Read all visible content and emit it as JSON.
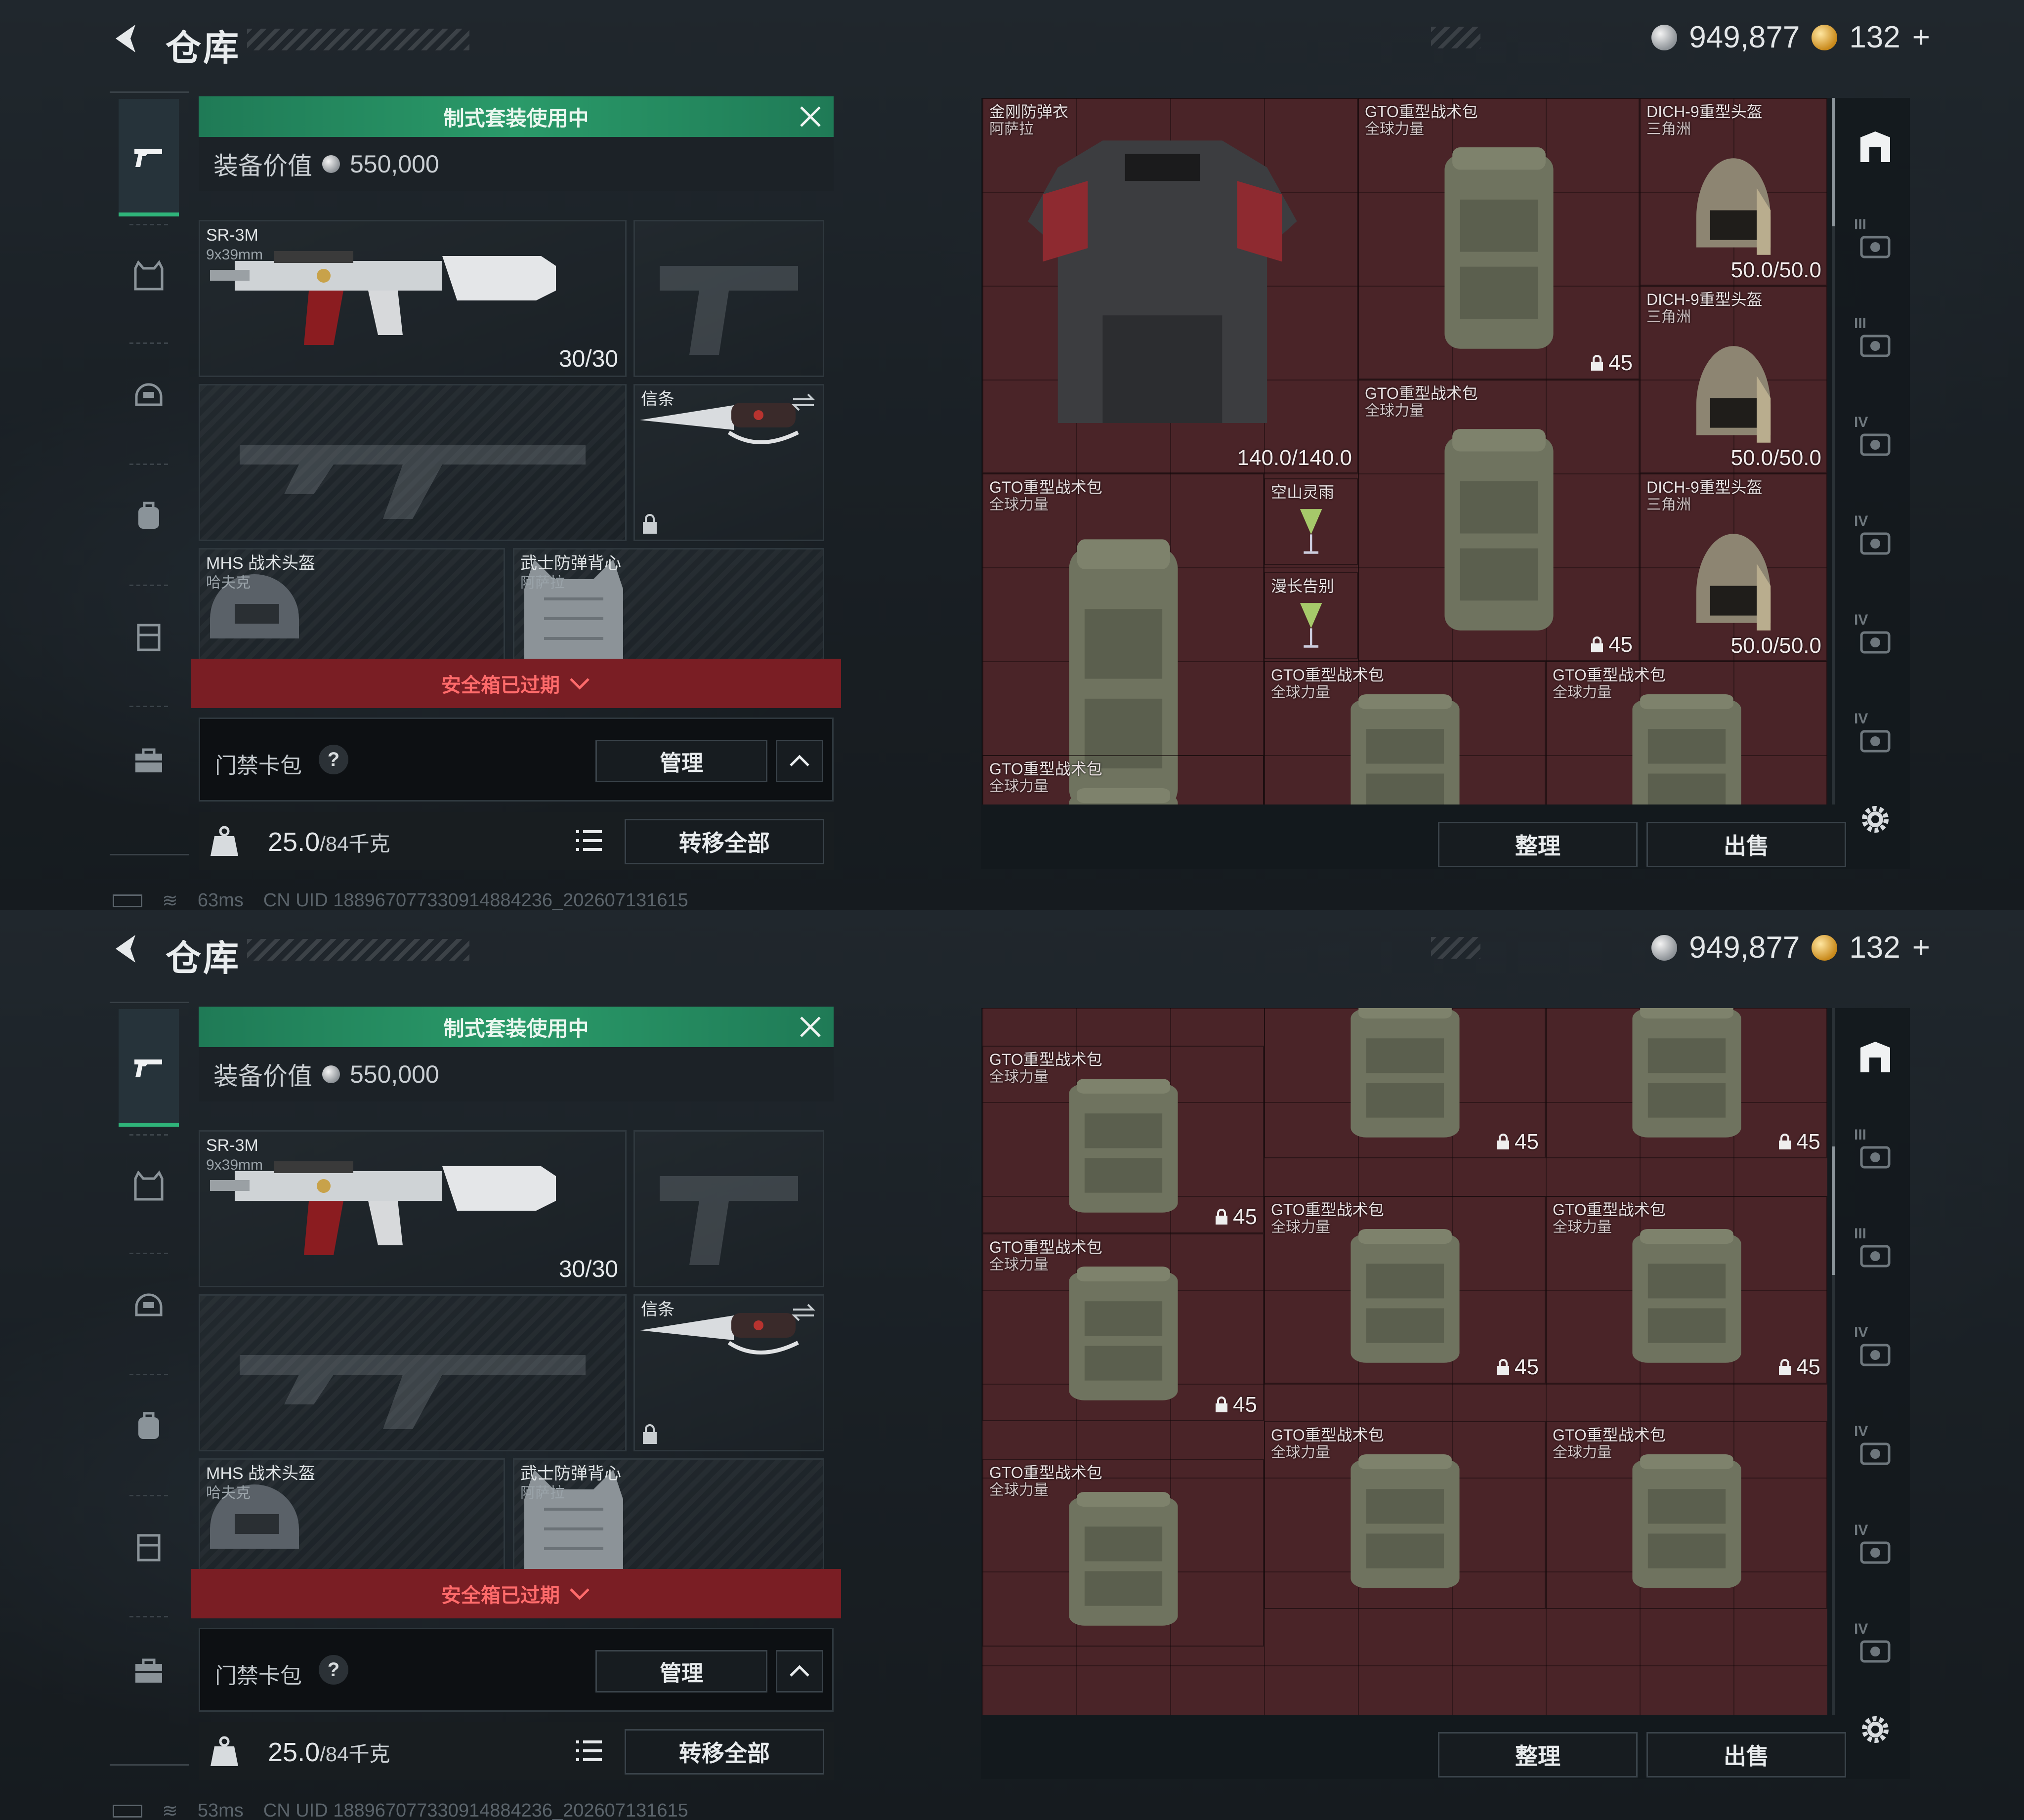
{
  "header": {
    "title": "仓库",
    "silver_amount": "949,877",
    "gold_amount": "132",
    "gold_plus": "+"
  },
  "nav": {
    "items": [
      "gun-icon",
      "vest-icon",
      "helmet-icon",
      "backpack-icon",
      "rig-icon",
      "briefcase-icon"
    ],
    "active": 0
  },
  "loadout": {
    "banner": "制式套装使用中",
    "equip_value_label": "装备价值",
    "equip_value": "550,000",
    "weapon": {
      "name": "SR-3M",
      "caliber": "9x39mm",
      "ammo": "30/30"
    },
    "melee": {
      "label": "信条"
    },
    "helmet": {
      "name": "MHS 战术头盔",
      "sub": "哈夫克"
    },
    "armor": {
      "name": "武士防弹背心",
      "sub": "阿萨拉"
    },
    "safe_box": "安全箱已过期",
    "card_pack": "门禁卡包",
    "help": "?",
    "manage": "管理",
    "weight": "25.0",
    "weight_unit": "/84千克",
    "transfer_all": "转移全部"
  },
  "status": {
    "ping_top": "63ms",
    "ping_bottom": "53ms",
    "uid": "CN UID 1889670773309148842​36_202607131615"
  },
  "stash": {
    "sort_label": "整理",
    "sell_label": "出售",
    "top_items": [
      {
        "name": "金刚防弹衣",
        "sub": "阿萨拉",
        "value": "140.0/140.0"
      },
      {
        "name": "GTO重型战术包",
        "sub": "全球力量",
        "cap": "45"
      },
      {
        "name": "DICH-9重型头盔",
        "sub": "三角洲",
        "value": "50.0/50.0"
      },
      {
        "name": "DICH-9重型头盔",
        "sub": "三角洲",
        "value": "50.0/50.0"
      },
      {
        "name": "GTO重型战术包",
        "sub": "全球力量",
        "cap": "45"
      },
      {
        "name": "DICH-9重型头盔",
        "sub": "三角洲",
        "value": "50.0/50.0"
      },
      {
        "name": "GTO重型战术包",
        "sub": "全球力量",
        "cap": "45"
      },
      {
        "name": "空山灵雨",
        "sub": ""
      },
      {
        "name": "漫长告别",
        "sub": ""
      },
      {
        "name": "GTO重型战术包",
        "sub": "全球力量"
      },
      {
        "name": "GTO重型战术包",
        "sub": "全球力量"
      },
      {
        "name": "GTO重型战术包",
        "sub": "全球力量"
      }
    ],
    "bottom_items": [
      {
        "name": "",
        "sub": "",
        "cap": "45"
      },
      {
        "name": "",
        "sub": "",
        "cap": "45"
      },
      {
        "name": "",
        "sub": "",
        "cap": "45"
      },
      {
        "name": "GTO重型战术包",
        "sub": "全球力量",
        "cap": "45"
      },
      {
        "name": "GTO重型战术包",
        "sub": "全球力量",
        "cap": "45"
      },
      {
        "name": "GTO重型战术包",
        "sub": "全球力量",
        "cap": "45"
      },
      {
        "name": "GTO重型战术包",
        "sub": "全球力量",
        "cap": "45"
      },
      {
        "name": "GTO重型战术包",
        "sub": "全球力量"
      },
      {
        "name": "GTO重型战术包",
        "sub": "全球力量"
      },
      {
        "name": "GTO重型战术包",
        "sub": "全球力量"
      }
    ],
    "rail_labels": [
      "III",
      "III",
      "IV",
      "IV",
      "IV",
      "IV"
    ]
  }
}
